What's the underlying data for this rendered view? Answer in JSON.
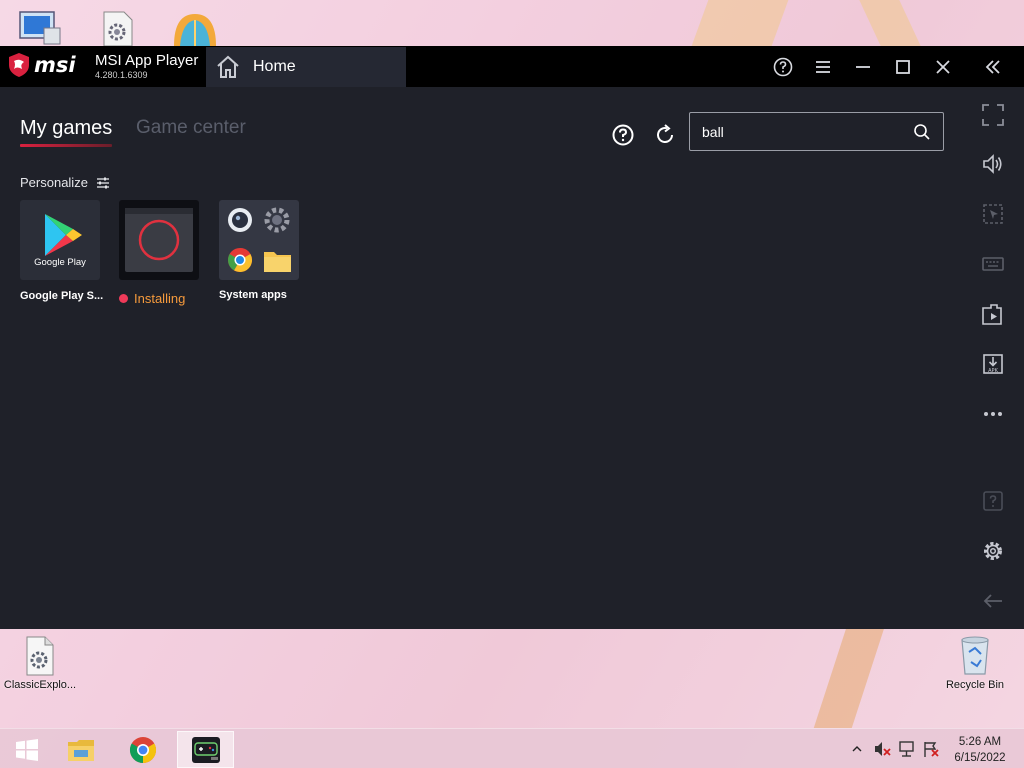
{
  "desktop": {
    "icons": [
      {
        "name": "ClassicExplo...",
        "kind": "settings-file-icon"
      },
      {
        "name": "Recycle Bin",
        "kind": "recycle-bin-icon"
      }
    ]
  },
  "app": {
    "brand": "msi",
    "name": "MSI App Player",
    "version": "4.280.1.6309",
    "tab": "Home",
    "tabs": {
      "my_games": "My games",
      "game_center": "Game center"
    },
    "search": {
      "value": "ball",
      "placeholder": ""
    },
    "personalize": "Personalize",
    "apps": [
      {
        "label": "Google Play S...",
        "inner_text": "Google Play"
      },
      {
        "label": "Installing",
        "status_color": "#ef3a59"
      },
      {
        "label": "System apps"
      }
    ]
  },
  "taskbar": {
    "time": "5:26 AM",
    "date": "6/15/2022"
  },
  "colors": {
    "accent": "#d9213f",
    "installing": "#f59a3c",
    "panel": "#1f2129",
    "titlebar": "#000000"
  }
}
